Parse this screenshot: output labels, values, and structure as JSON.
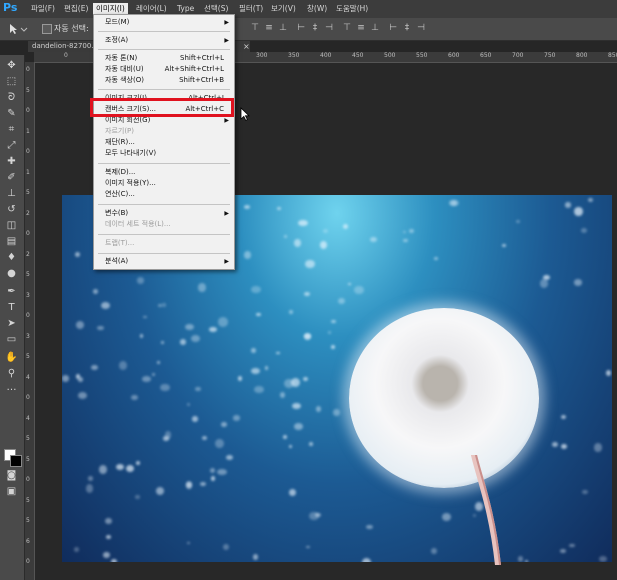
{
  "app": {
    "logo": "Ps"
  },
  "menubar": {
    "items": [
      "파일(F)",
      "편집(E)",
      "이미지(I)",
      "레이어(L)",
      "Type",
      "선택(S)",
      "필터(T)",
      "보기(V)",
      "창(W)",
      "도움말(H)"
    ],
    "active_index": 2
  },
  "options_bar": {
    "auto_select_label": "자동 선택:"
  },
  "document": {
    "tab_title": "dandelion-82700..."
  },
  "ruler": {
    "top": [
      "0",
      "50",
      "100",
      "150",
      "200",
      "250",
      "300",
      "350",
      "400",
      "450",
      "500",
      "550",
      "600",
      "650",
      "700",
      "750",
      "800",
      "850"
    ],
    "left": [
      "0",
      "5",
      "0",
      "1",
      "0",
      "1",
      "5",
      "2",
      "0",
      "2",
      "5",
      "3",
      "0",
      "3",
      "5",
      "4",
      "0",
      "4",
      "5",
      "5",
      "0",
      "5",
      "5",
      "6",
      "0"
    ]
  },
  "image_menu": {
    "items": [
      {
        "label": "모드(M)",
        "shortcut": "",
        "submenu": true,
        "disabled": false
      },
      {
        "label": "조정(A)",
        "shortcut": "",
        "submenu": true,
        "disabled": false
      },
      {
        "label": "자동 톤(N)",
        "shortcut": "Shift+Ctrl+L",
        "submenu": false,
        "disabled": false
      },
      {
        "label": "자동 대비(U)",
        "shortcut": "Alt+Shift+Ctrl+L",
        "submenu": false,
        "disabled": false
      },
      {
        "label": "자동 색상(O)",
        "shortcut": "Shift+Ctrl+B",
        "submenu": false,
        "disabled": false
      },
      {
        "label": "이미지 크기(I)...",
        "shortcut": "Alt+Ctrl+I",
        "submenu": false,
        "disabled": false
      },
      {
        "label": "캔버스 크기(S)...",
        "shortcut": "Alt+Ctrl+C",
        "submenu": false,
        "disabled": false
      },
      {
        "label": "이미지 회전(G)",
        "shortcut": "",
        "submenu": true,
        "disabled": false
      },
      {
        "label": "자르기(P)",
        "shortcut": "",
        "submenu": false,
        "disabled": true
      },
      {
        "label": "재단(R)...",
        "shortcut": "",
        "submenu": false,
        "disabled": false
      },
      {
        "label": "모두 나타내기(V)",
        "shortcut": "",
        "submenu": false,
        "disabled": false
      },
      {
        "label": "복제(D)...",
        "shortcut": "",
        "submenu": false,
        "disabled": false
      },
      {
        "label": "이미지 적용(Y)...",
        "shortcut": "",
        "submenu": false,
        "disabled": false
      },
      {
        "label": "연산(C)...",
        "shortcut": "",
        "submenu": false,
        "disabled": false
      },
      {
        "label": "변수(B)",
        "shortcut": "",
        "submenu": true,
        "disabled": false
      },
      {
        "label": "데이터 세트 적용(L)...",
        "shortcut": "",
        "submenu": false,
        "disabled": true
      },
      {
        "label": "트랩(T)...",
        "shortcut": "",
        "submenu": false,
        "disabled": true
      },
      {
        "label": "분석(A)",
        "shortcut": "",
        "submenu": true,
        "disabled": false
      }
    ],
    "highlighted_index": 6
  },
  "colors": {
    "highlight": "#e0121f",
    "menubar": "#3c3c3c",
    "menu_bg": "#f1f1f1"
  }
}
